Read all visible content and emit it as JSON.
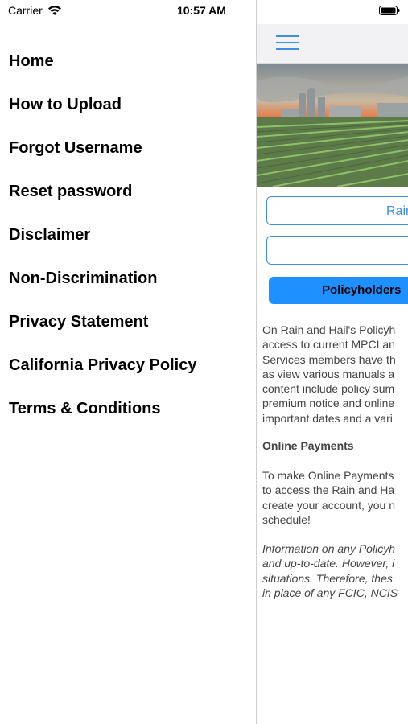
{
  "status_bar": {
    "carrier": "Carrier",
    "time": "10:57 AM"
  },
  "menu": {
    "items": [
      "Home",
      "How to Upload",
      "Forgot Username",
      "Reset password",
      "Disclaimer",
      "Non-Discrimination",
      "Privacy Statement",
      "California Privacy Policy",
      "Terms & Conditions"
    ]
  },
  "content": {
    "button_top": "Rain",
    "button_middle": "",
    "policyholders_button": "Policyholders",
    "intro_lines": [
      "On Rain and Hail's Policyh",
      "access to current MPCI an",
      "Services members have th",
      "as view various manuals a",
      "content include policy sum",
      "premium notice and online",
      "important dates and a vari"
    ],
    "online_payments_heading": "Online Payments",
    "payments_lines": [
      "To make Online Payments",
      "to access the Rain and Ha",
      "create your account, you n",
      "schedule!"
    ],
    "info_lines": [
      "Information on any Policyh",
      "and up-to-date. However, i",
      "situations. Therefore, thes",
      "in place of any FCIC, NCIS"
    ]
  }
}
